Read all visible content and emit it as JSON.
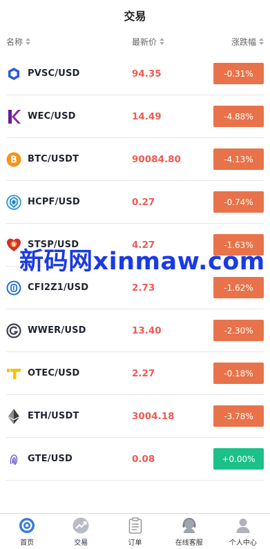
{
  "header": {
    "title": "交易"
  },
  "columns": {
    "name": "名称",
    "price": "最新价",
    "change": "涨跌幅"
  },
  "rows": [
    {
      "pair": "PVSC/USD",
      "price": "94.35",
      "change": "-0.31%",
      "dir": "down",
      "icon": "hexagon-coin-icon"
    },
    {
      "pair": "WEC/USD",
      "price": "14.49",
      "change": "-4.88%",
      "dir": "down",
      "icon": "k-logo-icon"
    },
    {
      "pair": "BTC/USDT",
      "price": "90084.80",
      "change": "-4.13%",
      "dir": "down",
      "icon": "bitcoin-icon"
    },
    {
      "pair": "HCPF/USD",
      "price": "0.27",
      "change": "-0.74%",
      "dir": "down",
      "icon": "blue-shield-coin-icon"
    },
    {
      "pair": "STSP/USD",
      "price": "4.27",
      "change": "-1.63%",
      "dir": "down",
      "icon": "heart-coin-icon"
    },
    {
      "pair": "CFI2Z1/USD",
      "price": "2.73",
      "change": "-1.62%",
      "dir": "down",
      "icon": "blue-coin-icon"
    },
    {
      "pair": "WWER/USD",
      "price": "13.40",
      "change": "-2.30%",
      "dir": "down",
      "icon": "g-ring-icon"
    },
    {
      "pair": "OTEC/USD",
      "price": "2.27",
      "change": "-0.18%",
      "dir": "down",
      "icon": "yellow-t-icon"
    },
    {
      "pair": "ETH/USDT",
      "price": "3004.18",
      "change": "-3.78%",
      "dir": "down",
      "icon": "ethereum-icon"
    },
    {
      "pair": "GTE/USD",
      "price": "0.08",
      "change": "+0.00%",
      "dir": "up",
      "icon": "fingerprint-icon"
    }
  ],
  "watermark": "新码网xinmaw.com",
  "tabbar": [
    {
      "label": "首页",
      "icon": "home-target-icon",
      "active": false
    },
    {
      "label": "交易",
      "icon": "trade-chart-icon",
      "active": true
    },
    {
      "label": "订单",
      "icon": "order-clipboard-icon",
      "active": false
    },
    {
      "label": "在线客服",
      "icon": "customer-service-icon",
      "active": false
    },
    {
      "label": "个人中心",
      "icon": "profile-person-icon",
      "active": false
    }
  ],
  "colors": {
    "price_red": "#ef5a50",
    "down_bg": "#e8734a",
    "up_bg": "#1bc188",
    "watermark": "#1a3ae6"
  }
}
